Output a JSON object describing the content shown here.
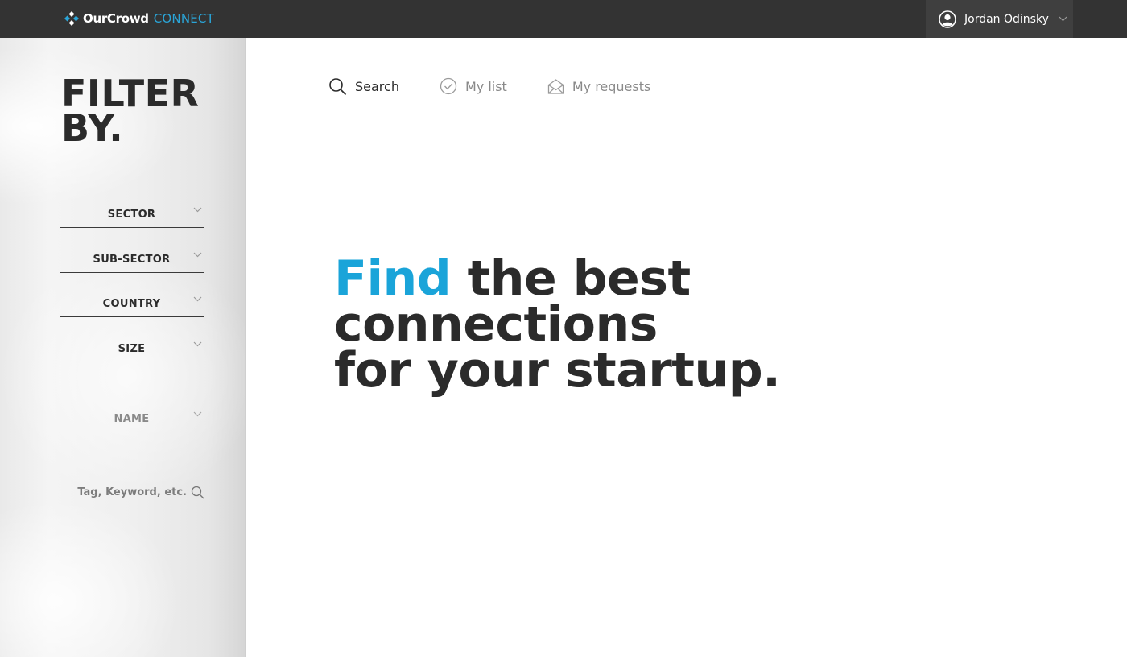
{
  "header": {
    "brand_name": "OurCrowd",
    "brand_product": "CONNECT",
    "brand_icon": "ourcrowd-logo-icon",
    "brand_color": "#2aa5d8",
    "user": {
      "name": "Jordan Odinsky",
      "avatar_icon": "user-avatar-icon",
      "menu_icon": "chevron-down-icon"
    }
  },
  "sidebar": {
    "title": "FILTER\nBY.",
    "filters": [
      {
        "label": "SECTOR",
        "icon": "chevron-down-icon"
      },
      {
        "label": "SUB-SECTOR",
        "icon": "chevron-down-icon"
      },
      {
        "label": "COUNTRY",
        "icon": "chevron-down-icon"
      },
      {
        "label": "SIZE",
        "icon": "chevron-down-icon"
      },
      {
        "label": "NAME",
        "icon": "chevron-down-icon"
      }
    ],
    "keyword_search": {
      "placeholder": "Tag, Keyword, etc.",
      "value": "",
      "icon": "search-icon"
    }
  },
  "tabs": [
    {
      "label": "Search",
      "icon": "search-icon",
      "active": true
    },
    {
      "label": "My list",
      "icon": "check-circle-icon",
      "active": false
    },
    {
      "label": "My requests",
      "icon": "envelope-open-icon",
      "active": false
    }
  ],
  "hero": {
    "accent_word": "Find",
    "line1_rest": " the best",
    "line2": "connections",
    "line3": "for your startup.",
    "accent_color": "#1aa4d9"
  }
}
